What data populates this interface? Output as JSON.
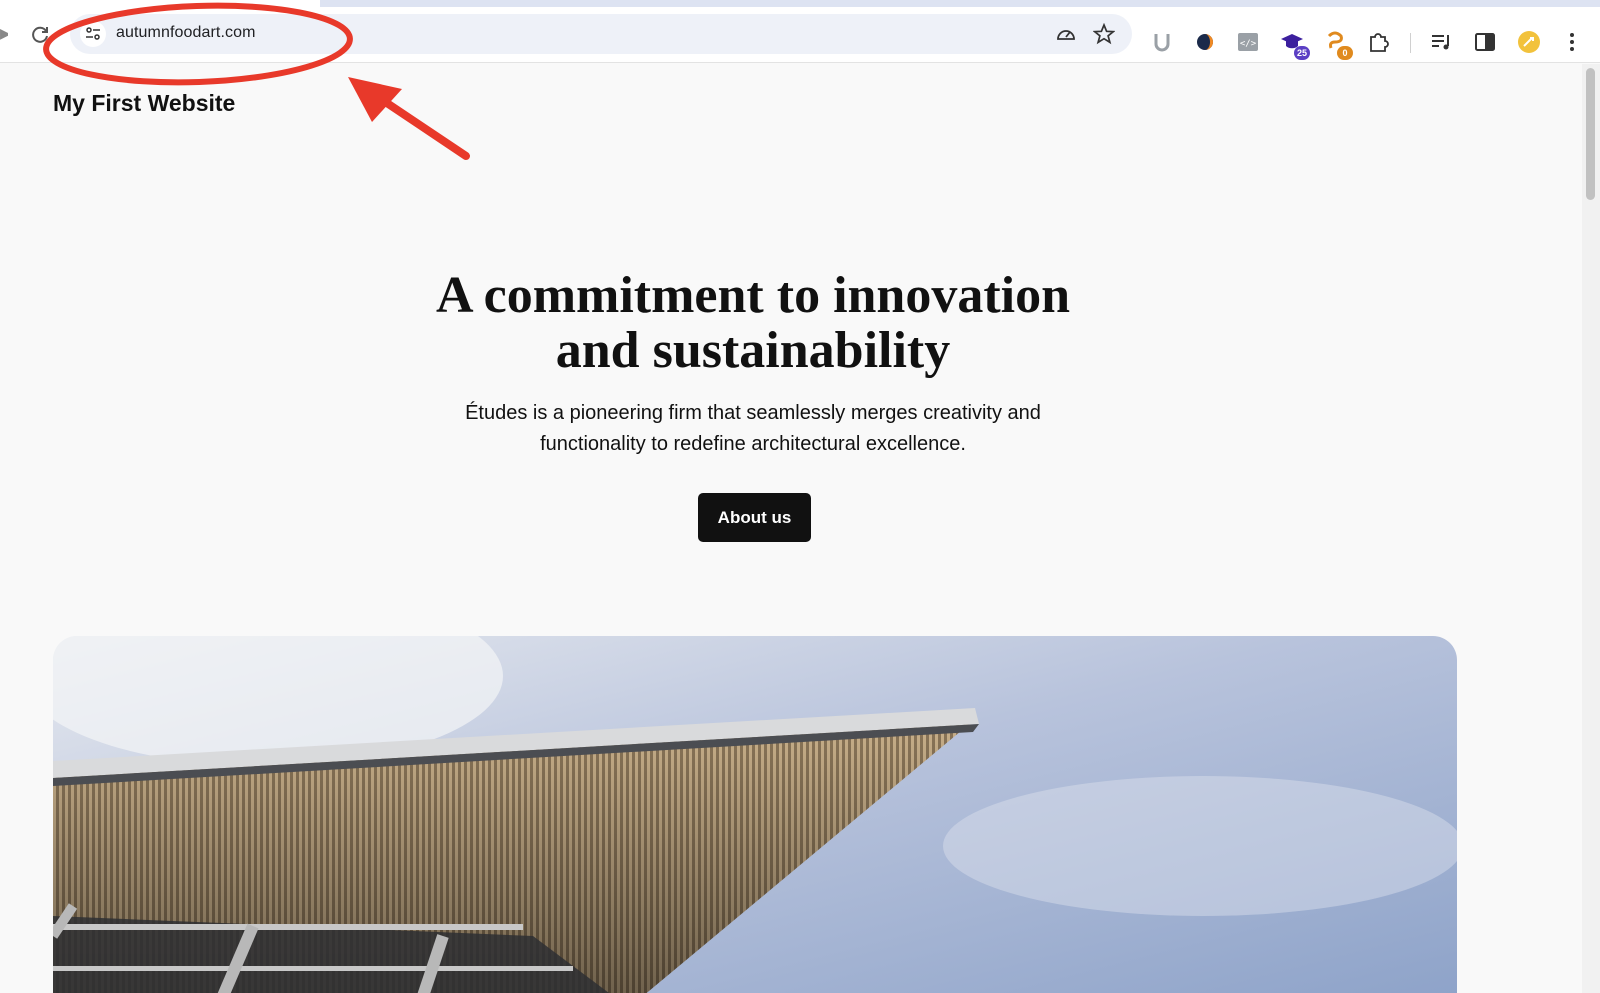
{
  "browser": {
    "url": "autumnfoodart.com",
    "extensions": [
      {
        "icon": "u-extension-icon"
      },
      {
        "icon": "dark-reader-icon"
      },
      {
        "icon": "code-viewer-icon"
      },
      {
        "icon": "graduation-cap-icon",
        "badge": "25",
        "badge_color": "#5b3fc4"
      },
      {
        "icon": "crab-extension-icon",
        "badge": "0",
        "badge_color": "#e08a1e"
      },
      {
        "icon": "puzzle-piece-icon"
      }
    ]
  },
  "site": {
    "title": "My First Website"
  },
  "hero": {
    "heading_line1": "A commitment to innovation",
    "heading_line2": "and sustainability",
    "text_line1": "Études is a pioneering firm that seamlessly merges creativity and",
    "text_line2": "functionality to redefine architectural excellence.",
    "button_label": "About us"
  },
  "colors": {
    "annotation_red": "#e8392a",
    "button_bg": "#111111",
    "page_bg": "#f9f9f9"
  }
}
